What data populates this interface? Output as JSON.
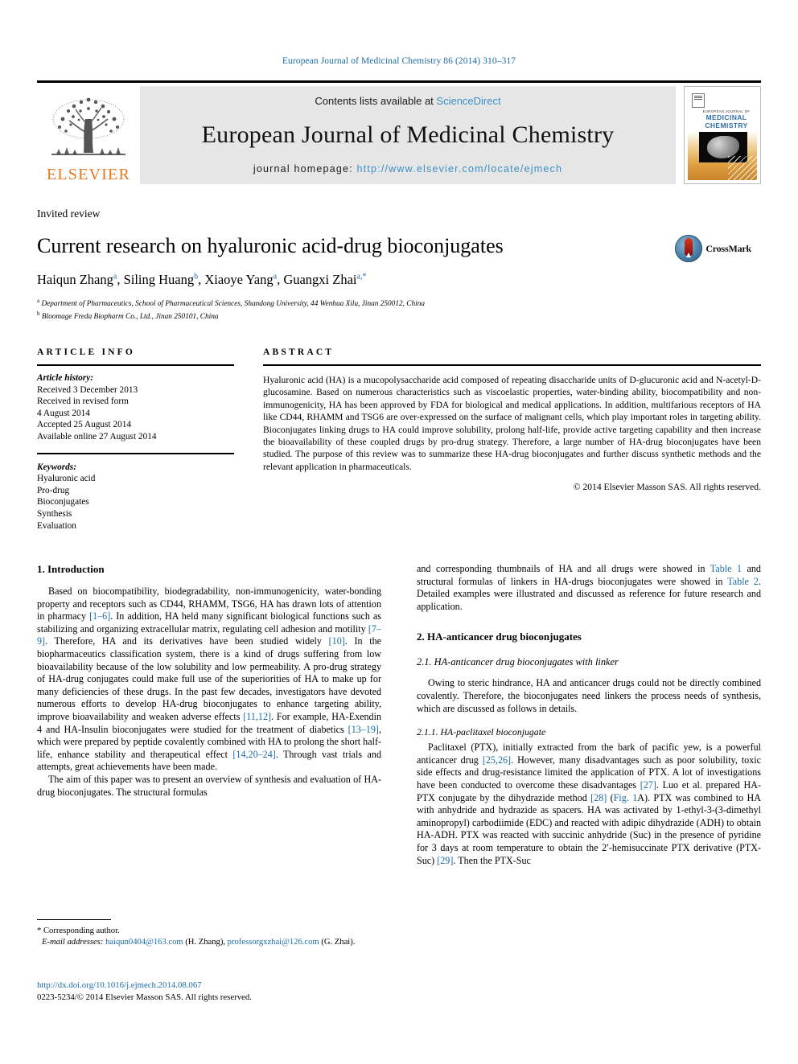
{
  "running_head": "European Journal of Medicinal Chemistry 86 (2014) 310–317",
  "masthead": {
    "contents_prefix": "Contents lists available at ",
    "sciencedirect": "ScienceDirect",
    "journal_name": "European Journal of Medicinal Chemistry",
    "homepage_label": "journal homepage: ",
    "homepage_url": "http://www.elsevier.com/locate/ejmech",
    "publisher_logo_text": "ELSEVIER",
    "cover": {
      "top_label": "EUROPEAN JOURNAL OF",
      "title_line1": "MEDICINAL",
      "title_line2": "CHEMISTRY"
    },
    "link_color": "#3a8fc4"
  },
  "article": {
    "type_label": "Invited review",
    "title": "Current research on hyaluronic acid-drug bioconjugates",
    "authors": [
      {
        "name": "Haiqun Zhang",
        "marks": "a"
      },
      {
        "name": "Siling Huang",
        "marks": "b"
      },
      {
        "name": "Xiaoye Yang",
        "marks": "a"
      },
      {
        "name": "Guangxi Zhai",
        "marks": "a,*"
      }
    ],
    "affiliations": [
      {
        "mark": "a",
        "text": "Department of Pharmaceutics, School of Pharmaceutical Sciences, Shandong University, 44 Wenhua Xilu, Jinan 250012, China"
      },
      {
        "mark": "b",
        "text": "Bloomage Freda Biopharm Co., Ltd., Jinan 250101, China"
      }
    ],
    "crossmark_label": "CrossMark"
  },
  "article_info": {
    "heading": "ARTICLE INFO",
    "history_label": "Article history:",
    "history": [
      "Received 3 December 2013",
      "Received in revised form",
      "4 August 2014",
      "Accepted 25 August 2014",
      "Available online 27 August 2014"
    ],
    "keywords_label": "Keywords:",
    "keywords": [
      "Hyaluronic acid",
      "Pro-drug",
      "Bioconjugates",
      "Synthesis",
      "Evaluation"
    ]
  },
  "abstract": {
    "heading": "ABSTRACT",
    "text": "Hyaluronic acid (HA) is a mucopolysaccharide acid composed of repeating disaccharide units of D-glucuronic acid and N-acetyl-D-glucosamine. Based on numerous characteristics such as viscoelastic properties, water-binding ability, biocompatibility and non-immunogenicity, HA has been approved by FDA for biological and medical applications. In addition, multifarious receptors of HA like CD44, RHAMM and TSG6 are over-expressed on the surface of malignant cells, which play important roles in targeting ability. Bioconjugates linking drugs to HA could improve solubility, prolong half-life, provide active targeting capability and then increase the bioavailability of these coupled drugs by pro-drug strategy. Therefore, a large number of HA-drug bioconjugates have been studied. The purpose of this review was to summarize these HA-drug bioconjugates and further discuss synthetic methods and the relevant application in pharmaceuticals.",
    "copyright": "© 2014 Elsevier Masson SAS. All rights reserved."
  },
  "body": {
    "left_column": {
      "section_heading": "1. Introduction",
      "paragraph_1_parts": [
        {
          "t": "Based on biocompatibility, biodegradability, non-immunogenicity, water-bonding property and receptors such as CD44, RHAMM, TSG6, HA has drawn lots of attention in pharmacy "
        },
        {
          "t": "[1–6]",
          "ref": true
        },
        {
          "t": ". In addition, HA held many significant biological functions such as stabilizing and organizing extracellular matrix, regulating cell adhesion and motility "
        },
        {
          "t": "[7–9]",
          "ref": true
        },
        {
          "t": ". Therefore, HA and its derivatives have been studied widely "
        },
        {
          "t": "[10]",
          "ref": true
        },
        {
          "t": ". In the biopharmaceutics classification system, there is a kind of drugs suffering from low bioavailability because of the low solubility and low permeability. A pro-drug strategy of HA-drug conjugates could make full use of the superiorities of HA to make up for many deficiencies of these drugs. In the past few decades, investigators have devoted numerous efforts to develop HA-drug bioconjugates to enhance targeting ability, improve bioavailability and weaken adverse effects "
        },
        {
          "t": "[11,12]",
          "ref": true
        },
        {
          "t": ". For example, HA-Exendin 4 and HA-Insulin bioconjugates were studied for the treatment of diabetics "
        },
        {
          "t": "[13–19]",
          "ref": true
        },
        {
          "t": ", which were prepared by peptide covalently combined with HA to prolong the short half-life, enhance stability and therapeutical effect "
        },
        {
          "t": "[14,20–24]",
          "ref": true
        },
        {
          "t": ". Through vast trials and attempts, great achievements have been made."
        }
      ],
      "paragraph_2": "The aim of this paper was to present an overview of synthesis and evaluation of HA-drug bioconjugates. The structural formulas"
    },
    "right_column": {
      "paragraph_1_parts": [
        {
          "t": "and corresponding thumbnails of HA and all drugs were showed in "
        },
        {
          "t": "Table 1",
          "ref": true
        },
        {
          "t": " and structural formulas of linkers in HA-drugs bioconjugates were showed in "
        },
        {
          "t": "Table 2",
          "ref": true
        },
        {
          "t": ". Detailed examples were illustrated and discussed as reference for future research and application."
        }
      ],
      "section_heading": "2. HA-anticancer drug bioconjugates",
      "sub_heading": "2.1. HA-anticancer drug bioconjugates with linker",
      "paragraph_2": "Owing to steric hindrance, HA and anticancer drugs could not be directly combined covalently. Therefore, the bioconjugates need linkers the process needs of synthesis, which are discussed as follows in details.",
      "subsub_heading": "2.1.1. HA-paclitaxel bioconjugate",
      "paragraph_3_parts": [
        {
          "t": "Paclitaxel (PTX), initially extracted from the bark of pacific yew, is a powerful anticancer drug "
        },
        {
          "t": "[25,26]",
          "ref": true
        },
        {
          "t": ". However, many disadvantages such as poor solubility, toxic side effects and drug-resistance limited the application of PTX. A lot of investigations have been conducted to overcome these disadvantages "
        },
        {
          "t": "[27]",
          "ref": true
        },
        {
          "t": ". Luo et al. prepared HA-PTX conjugate by the dihydrazide method "
        },
        {
          "t": "[28]",
          "ref": true
        },
        {
          "t": " ("
        },
        {
          "t": "Fig. 1",
          "ref": true
        },
        {
          "t": "A). PTX was combined to HA with anhydride and hydrazide as spacers. HA was activated by 1-ethyl-3-(3-dimethyl aminopropyl) carbodiimide (EDC) and reacted with adipic dihydrazide (ADH) to obtain HA-ADH. PTX was reacted with succinic anhydride (Suc) in the presence of pyridine for 3 days at room temperature to obtain the 2′-hemisuccinate PTX derivative (PTX-Suc) "
        },
        {
          "t": "[29]",
          "ref": true
        },
        {
          "t": ". Then the PTX-Suc"
        }
      ]
    }
  },
  "footnote": {
    "corresponding": "* Corresponding author.",
    "email_label": "E-mail addresses:",
    "email_1": "haiqun0404@163.com",
    "email_1_owner": "(H. Zhang),",
    "email_2": "professorgxzhai@126.com",
    "email_2_owner": "(G. Zhai)."
  },
  "doi_block": {
    "doi_url": "http://dx.doi.org/10.1016/j.ejmech.2014.08.067",
    "issn_line": "0223-5234/© 2014 Elsevier Masson SAS. All rights reserved."
  },
  "colors": {
    "link": "#1b6ca8",
    "elsevier_orange": "#E87722",
    "masthead_bg": "#e6e6e6"
  }
}
